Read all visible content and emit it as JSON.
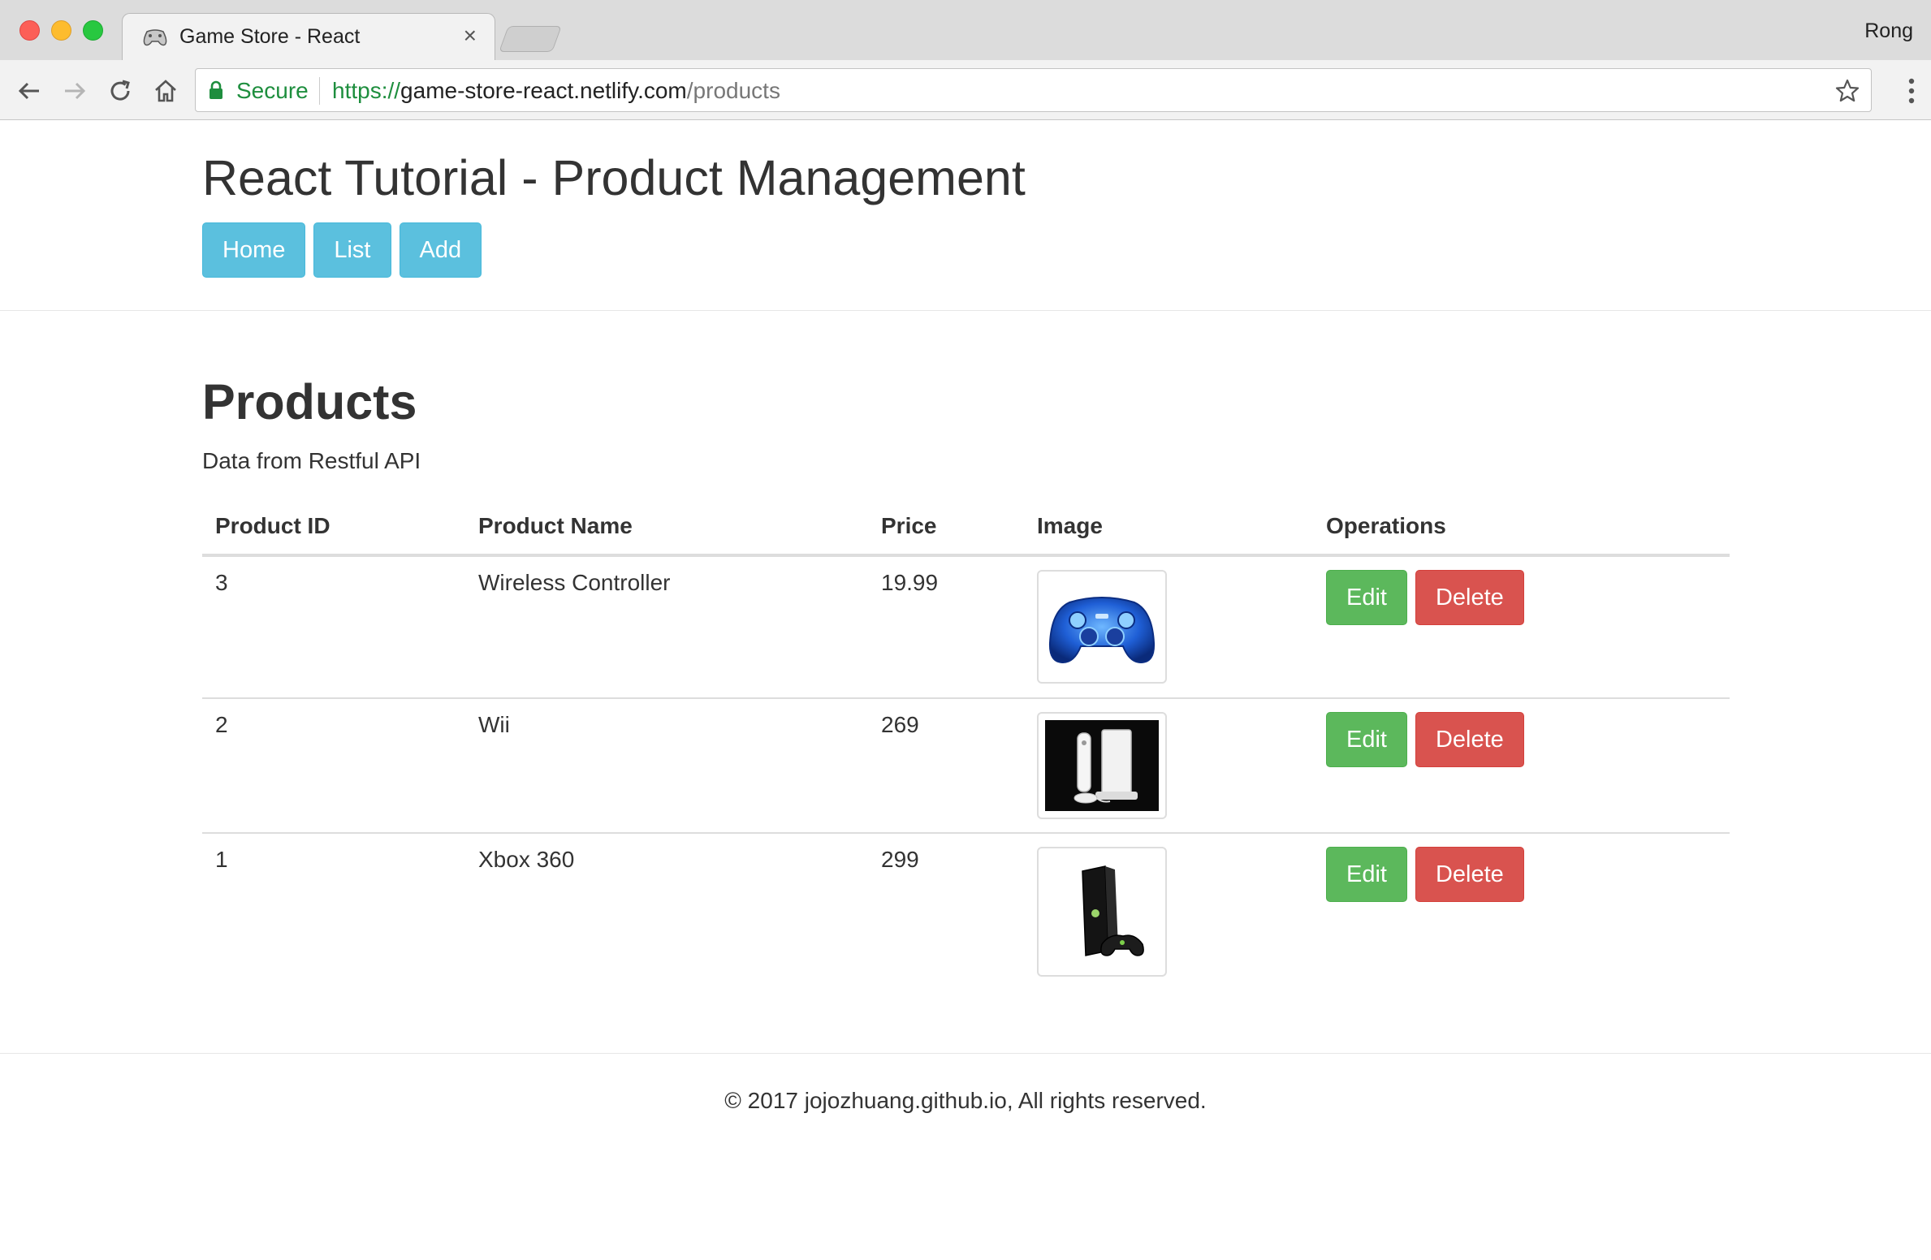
{
  "browser": {
    "tab_title": "Game Store - React",
    "tab_close": "×",
    "profile_name": "Rong",
    "security_label": "Secure",
    "url_scheme": "https://",
    "url_host": "game-store-react.netlify.com",
    "url_path": "/products"
  },
  "header": {
    "title": "React Tutorial - Product Management",
    "nav": {
      "home": "Home",
      "list": "List",
      "add": "Add"
    }
  },
  "main": {
    "title": "Products",
    "subtitle": "Data from Restful API",
    "table": {
      "headers": {
        "id": "Product ID",
        "name": "Product Name",
        "price": "Price",
        "image": "Image",
        "operations": "Operations"
      },
      "rows": [
        {
          "id": "3",
          "name": "Wireless Controller",
          "price": "19.99",
          "image_icon": "game-controller-image"
        },
        {
          "id": "2",
          "name": "Wii",
          "price": "269",
          "image_icon": "wii-console-image"
        },
        {
          "id": "1",
          "name": "Xbox 360",
          "price": "299",
          "image_icon": "xbox-360-console-image"
        }
      ],
      "edit_label": "Edit",
      "delete_label": "Delete"
    }
  },
  "footer": {
    "text": "© 2017 jojozhuang.github.io, All rights reserved."
  },
  "colors": {
    "info": "#5bc0de",
    "success": "#5cb85c",
    "danger": "#d9534f",
    "secure": "#1e8e3e"
  }
}
